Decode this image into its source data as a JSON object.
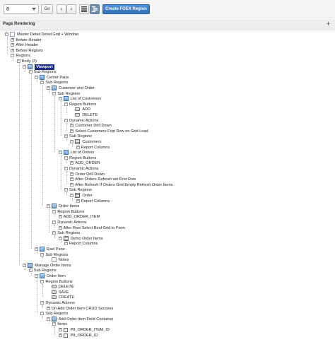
{
  "toolbar": {
    "page_value": "8",
    "go_label": "Go",
    "prev_glyph": "‹",
    "next_glyph": "›",
    "grid_icon": "grid-view-icon",
    "tree_icon": "tree-view-icon",
    "create_label": "Create FOEX Region"
  },
  "panel": {
    "title": "Page Rendering",
    "plus_glyph": "+"
  },
  "tree": [
    {
      "label": "Master Detail Detail Grid + Window",
      "icon": "page",
      "tog": "-",
      "depth": 0
    },
    {
      "label": "Before Header",
      "tog": "+",
      "depth": 1
    },
    {
      "label": "After Header",
      "tog": "+",
      "depth": 1
    },
    {
      "label": "Before Regions",
      "tog": "+",
      "depth": 1
    },
    {
      "label": "Regions",
      "tog": "-",
      "depth": 1
    },
    {
      "label": "Body (3)",
      "tog": "-",
      "depth": 2
    },
    {
      "label": "Viewport",
      "icon": "region",
      "tog": "-",
      "depth": 3,
      "selected": true
    },
    {
      "label": "Sub Regions",
      "tog": "-",
      "depth": 4
    },
    {
      "label": "Center Pane",
      "icon": "region",
      "tog": "-",
      "depth": 5
    },
    {
      "label": "Sub Regions",
      "tog": "-",
      "depth": 6
    },
    {
      "label": "Customer and Order",
      "icon": "region",
      "tog": "-",
      "depth": 7
    },
    {
      "label": "Sub Regions",
      "tog": "-",
      "depth": 8
    },
    {
      "label": "List of Customers",
      "icon": "region",
      "tog": "-",
      "depth": 9
    },
    {
      "label": "Region Buttons",
      "tog": "-",
      "depth": 10
    },
    {
      "label": "ADD",
      "icon": "btn",
      "depth": 11
    },
    {
      "label": "DELETE",
      "icon": "btn",
      "depth": 11
    },
    {
      "label": "Dynamic Actions",
      "tog": "-",
      "depth": 10
    },
    {
      "label": "Customer Drill Down",
      "tog": "+",
      "depth": 11
    },
    {
      "label": "Select Customers Frist Row on Grid Load",
      "tog": "+",
      "depth": 11
    },
    {
      "label": "Sub Regions",
      "tog": "-",
      "depth": 10
    },
    {
      "label": "Customers",
      "icon": "report",
      "tog": "-",
      "depth": 11
    },
    {
      "label": "Report Columns",
      "tog": "+",
      "depth": 12
    },
    {
      "label": "List of Orders",
      "icon": "region",
      "tog": "-",
      "depth": 9
    },
    {
      "label": "Region Buttons",
      "tog": "-",
      "depth": 10
    },
    {
      "label": "ADD_ORDER",
      "tog": "+",
      "depth": 11
    },
    {
      "label": "Dynamic Actions",
      "tog": "-",
      "depth": 10
    },
    {
      "label": "Order Drill Down",
      "tog": "+",
      "depth": 11
    },
    {
      "label": "After Orders Refresh set First Row",
      "tog": "+",
      "depth": 11
    },
    {
      "label": "After Refresh If Orders Grid Empty Refresh Order Items",
      "tog": "+",
      "depth": 11
    },
    {
      "label": "Sub Regions",
      "tog": "-",
      "depth": 10
    },
    {
      "label": "Order",
      "icon": "report",
      "tog": "-",
      "depth": 11
    },
    {
      "label": "Report Columns",
      "tog": "+",
      "depth": 12
    },
    {
      "label": "Order Items",
      "icon": "region",
      "tog": "-",
      "depth": 7
    },
    {
      "label": "Region Buttons",
      "tog": "-",
      "depth": 8
    },
    {
      "label": "ADD_ORDER_ITEM",
      "tog": "+",
      "depth": 9
    },
    {
      "label": "Dynamic Actions",
      "tog": "-",
      "depth": 8
    },
    {
      "label": "After Row Select Bind Grid to Form",
      "tog": "+",
      "depth": 9
    },
    {
      "label": "Sub Regions",
      "tog": "-",
      "depth": 8
    },
    {
      "label": "Demo Order Items",
      "icon": "report",
      "tog": "-",
      "depth": 9
    },
    {
      "label": "Report Columns",
      "tog": "+",
      "depth": 10
    },
    {
      "label": "East Pane",
      "icon": "region",
      "tog": "-",
      "depth": 5
    },
    {
      "label": "Sub Regions",
      "tog": "-",
      "depth": 6
    },
    {
      "label": "Notes",
      "icon": "page",
      "depth": 7
    },
    {
      "label": "Manage Order Items",
      "icon": "region",
      "tog": "-",
      "depth": 3
    },
    {
      "label": "Sub Regions",
      "tog": "-",
      "depth": 4
    },
    {
      "label": "Order Item",
      "icon": "region",
      "tog": "-",
      "depth": 5
    },
    {
      "label": "Region Buttons",
      "tog": "-",
      "depth": 6
    },
    {
      "label": "DELETE",
      "icon": "btn",
      "italic": true,
      "depth": 7
    },
    {
      "label": "SAVE",
      "icon": "btn",
      "depth": 7
    },
    {
      "label": "CREATE",
      "icon": "btn",
      "depth": 7
    },
    {
      "label": "Dynamic Actions",
      "tog": "-",
      "depth": 6
    },
    {
      "label": "On Add Order Item CRUD Success",
      "tog": "+",
      "depth": 7
    },
    {
      "label": "Sub Regions",
      "tog": "-",
      "depth": 6
    },
    {
      "label": "Add Order Item Field Container",
      "icon": "region",
      "tog": "-",
      "depth": 7
    },
    {
      "label": "Items",
      "tog": "-",
      "depth": 8
    },
    {
      "label": "P8_ORDER_ITEM_ID",
      "icon": "item",
      "tog": "+",
      "depth": 9
    },
    {
      "label": "P8_ORDER_ID",
      "icon": "item",
      "tog": "+",
      "depth": 9
    }
  ]
}
